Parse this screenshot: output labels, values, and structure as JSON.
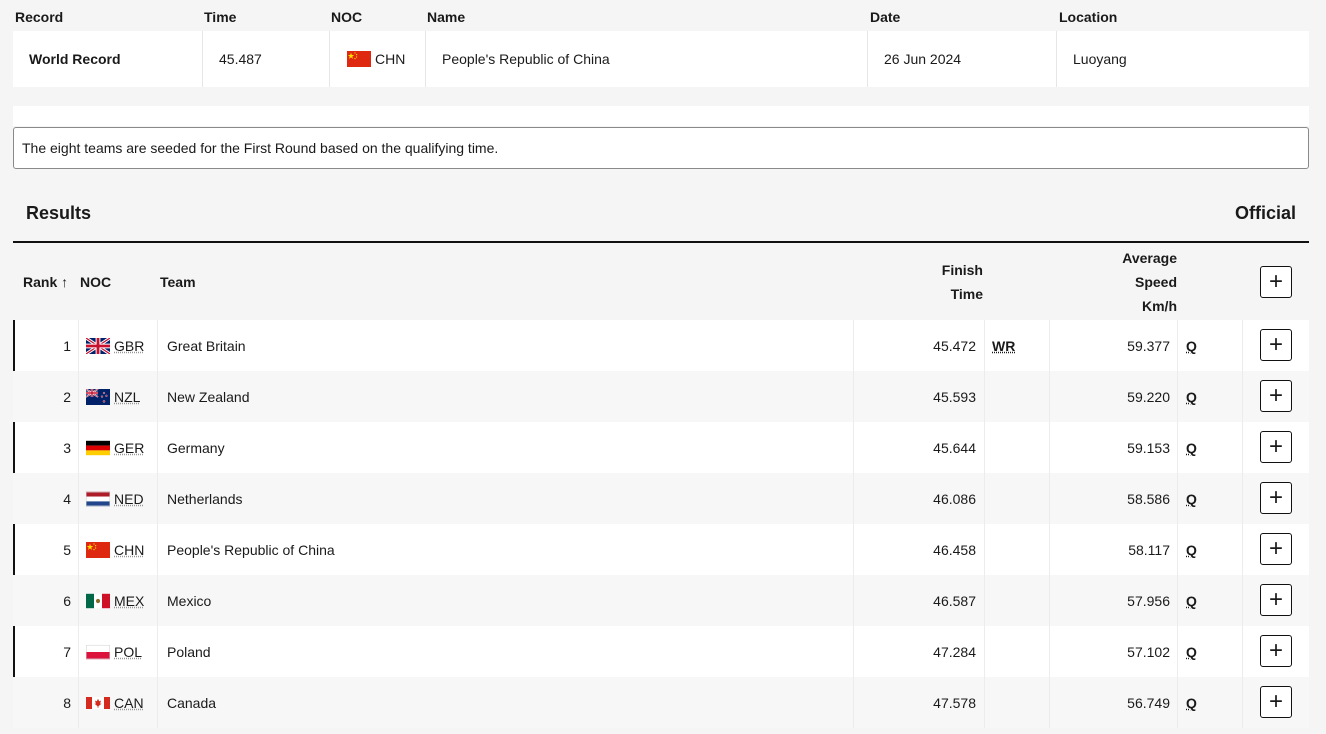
{
  "record_table": {
    "headers": {
      "record": "Record",
      "time": "Time",
      "noc": "NOC",
      "name": "Name",
      "date": "Date",
      "location": "Location"
    },
    "row": {
      "record": "World Record",
      "time": "45.487",
      "noc": "CHN",
      "name": "People's Republic of China",
      "date": "26 Jun 2024",
      "location": "Luoyang"
    }
  },
  "note": "The eight teams are seeded for the First Round based on the qualifying time.",
  "results": {
    "title": "Results",
    "status": "Official",
    "headers": {
      "rank": "Rank",
      "rank_sort_icon": "↑",
      "noc": "NOC",
      "team": "Team",
      "finish_time_1": "Finish",
      "finish_time_2": "Time",
      "avg_speed_1": "Average",
      "avg_speed_2": "Speed",
      "avg_speed_3": "Km/h",
      "expand_all": "+"
    },
    "rows": [
      {
        "rank": "1",
        "noc": "GBR",
        "team": "Great Britain",
        "time": "45.472",
        "record": "WR",
        "speed": "59.377",
        "qual": "Q",
        "expand": "+"
      },
      {
        "rank": "2",
        "noc": "NZL",
        "team": "New Zealand",
        "time": "45.593",
        "record": "",
        "speed": "59.220",
        "qual": "Q",
        "expand": "+"
      },
      {
        "rank": "3",
        "noc": "GER",
        "team": "Germany",
        "time": "45.644",
        "record": "",
        "speed": "59.153",
        "qual": "Q",
        "expand": "+"
      },
      {
        "rank": "4",
        "noc": "NED",
        "team": "Netherlands",
        "time": "46.086",
        "record": "",
        "speed": "58.586",
        "qual": "Q",
        "expand": "+"
      },
      {
        "rank": "5",
        "noc": "CHN",
        "team": "People's Republic of China",
        "time": "46.458",
        "record": "",
        "speed": "58.117",
        "qual": "Q",
        "expand": "+"
      },
      {
        "rank": "6",
        "noc": "MEX",
        "team": "Mexico",
        "time": "46.587",
        "record": "",
        "speed": "57.956",
        "qual": "Q",
        "expand": "+"
      },
      {
        "rank": "7",
        "noc": "POL",
        "team": "Poland",
        "time": "47.284",
        "record": "",
        "speed": "57.102",
        "qual": "Q",
        "expand": "+"
      },
      {
        "rank": "8",
        "noc": "CAN",
        "team": "Canada",
        "time": "47.578",
        "record": "",
        "speed": "56.749",
        "qual": "Q",
        "expand": "+"
      }
    ]
  },
  "icons": {
    "flags": [
      "gbr-flag-icon",
      "nzl-flag-icon",
      "ger-flag-icon",
      "ned-flag-icon",
      "chn-flag-icon",
      "mex-flag-icon",
      "pol-flag-icon",
      "can-flag-icon"
    ],
    "sort": "arrow-up-icon",
    "expand": "plus-icon"
  }
}
